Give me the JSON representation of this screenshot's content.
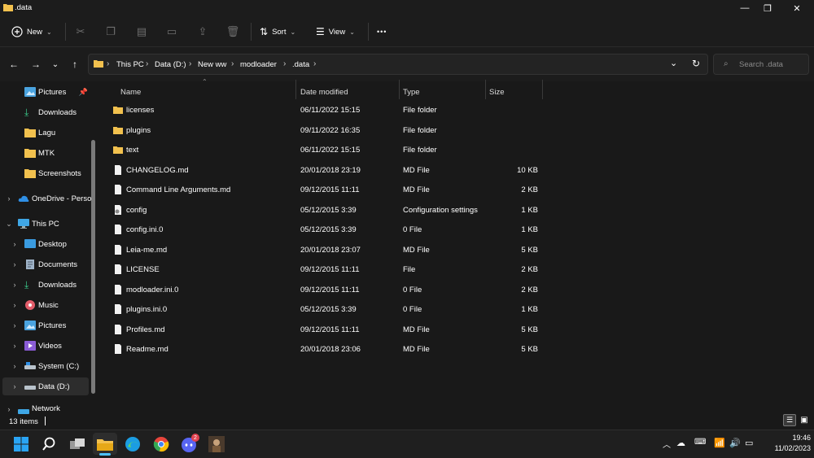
{
  "window": {
    "title": ".data",
    "minimize_glyph": "—",
    "maximize_glyph": "❐",
    "close_glyph": "✕"
  },
  "toolbar": {
    "new_label": "New",
    "sort_label": "Sort",
    "view_label": "View",
    "more_glyph": "•••",
    "icons": [
      "cut-icon",
      "copy-icon",
      "paste-icon",
      "rename-icon",
      "share-icon",
      "delete-icon"
    ]
  },
  "address": {
    "crumbs": [
      "This PC",
      "Data (D:)",
      "New ww",
      "modloader",
      ".data"
    ],
    "search_placeholder": "Search .data"
  },
  "sidebar": {
    "items": [
      {
        "label": "Pictures",
        "icon": "pictures-icon",
        "indent": 2,
        "pinned": true
      },
      {
        "label": "Downloads",
        "icon": "downloads-icon",
        "indent": 2
      },
      {
        "label": "Lagu",
        "icon": "folder-icon",
        "indent": 2
      },
      {
        "label": "MTK",
        "icon": "folder-icon",
        "indent": 2
      },
      {
        "label": "Screenshots",
        "icon": "folder-icon",
        "indent": 2
      },
      {
        "label": "OneDrive - Perso",
        "icon": "onedrive-icon",
        "indent": 1,
        "chevron": "›"
      },
      {
        "label": "This PC",
        "icon": "pc-icon",
        "indent": 1,
        "chevron": "⌄"
      },
      {
        "label": "Desktop",
        "icon": "desktop-icon",
        "indent": 2,
        "chevron": "›"
      },
      {
        "label": "Documents",
        "icon": "documents-icon",
        "indent": 2,
        "chevron": "›"
      },
      {
        "label": "Downloads",
        "icon": "downloads-icon",
        "indent": 2,
        "chevron": "›"
      },
      {
        "label": "Music",
        "icon": "music-icon",
        "indent": 2,
        "chevron": "›"
      },
      {
        "label": "Pictures",
        "icon": "pictures-icon",
        "indent": 2,
        "chevron": "›"
      },
      {
        "label": "Videos",
        "icon": "videos-icon",
        "indent": 2,
        "chevron": "›"
      },
      {
        "label": "System (C:)",
        "icon": "drive-icon",
        "indent": 2,
        "chevron": "›"
      },
      {
        "label": "Data (D:)",
        "icon": "drive-icon",
        "indent": 2,
        "chevron": "›",
        "selected": true
      },
      {
        "label": "Network",
        "icon": "network-icon",
        "indent": 1,
        "chevron": "›"
      }
    ]
  },
  "files": {
    "columns": [
      "Name",
      "Date modified",
      "Type",
      "Size"
    ],
    "rows": [
      {
        "name": "licenses",
        "date": "06/11/2022 15:15",
        "type": "File folder",
        "size": "",
        "icon": "folder-icon"
      },
      {
        "name": "plugins",
        "date": "09/11/2022 16:35",
        "type": "File folder",
        "size": "",
        "icon": "folder-icon"
      },
      {
        "name": "text",
        "date": "06/11/2022 15:15",
        "type": "File folder",
        "size": "",
        "icon": "folder-icon"
      },
      {
        "name": "CHANGELOG.md",
        "date": "20/01/2018 23:19",
        "type": "MD File",
        "size": "10 KB",
        "icon": "file-icon"
      },
      {
        "name": "Command Line Arguments.md",
        "date": "09/12/2015 11:11",
        "type": "MD File",
        "size": "2 KB",
        "icon": "file-icon"
      },
      {
        "name": "config",
        "date": "05/12/2015 3:39",
        "type": "Configuration settings",
        "size": "1 KB",
        "icon": "config-file-icon"
      },
      {
        "name": "config.ini.0",
        "date": "05/12/2015 3:39",
        "type": "0 File",
        "size": "1 KB",
        "icon": "file-icon"
      },
      {
        "name": "Leia-me.md",
        "date": "20/01/2018 23:07",
        "type": "MD File",
        "size": "5 KB",
        "icon": "file-icon"
      },
      {
        "name": "LICENSE",
        "date": "09/12/2015 11:11",
        "type": "File",
        "size": "2 KB",
        "icon": "file-icon"
      },
      {
        "name": "modloader.ini.0",
        "date": "09/12/2015 11:11",
        "type": "0 File",
        "size": "2 KB",
        "icon": "file-icon"
      },
      {
        "name": "plugins.ini.0",
        "date": "05/12/2015 3:39",
        "type": "0 File",
        "size": "1 KB",
        "icon": "file-icon"
      },
      {
        "name": "Profiles.md",
        "date": "09/12/2015 11:11",
        "type": "MD File",
        "size": "5 KB",
        "icon": "file-icon"
      },
      {
        "name": "Readme.md",
        "date": "20/01/2018 23:06",
        "type": "MD File",
        "size": "5 KB",
        "icon": "file-icon"
      }
    ]
  },
  "status": {
    "items_text": "13 items"
  },
  "taskbar": {
    "time": "19:46",
    "date": "11/02/2023",
    "discord_badge": "2"
  },
  "colors": {
    "folder": "#f2c14e",
    "accent": "#0078d4"
  }
}
